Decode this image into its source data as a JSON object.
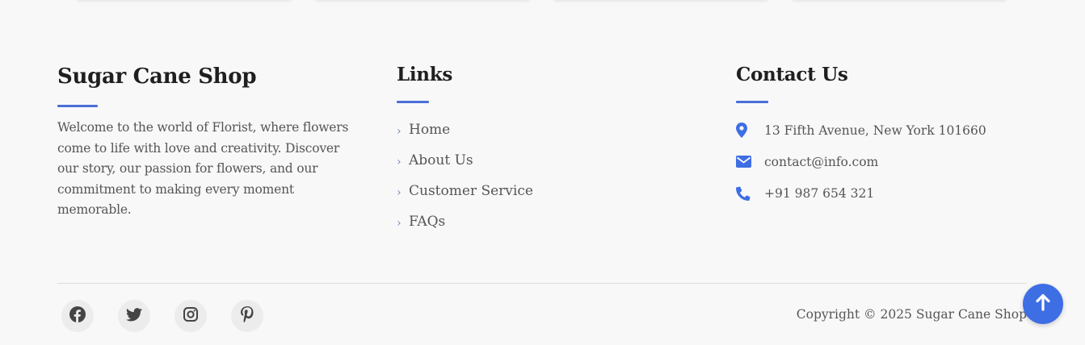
{
  "brand": {
    "title": "Sugar Cane Shop",
    "description": "Welcome to the world of Florist, where flowers come to life with love and creativity. Discover our story, our passion for flowers, and our commitment to making every moment memorable."
  },
  "links": {
    "title": "Links",
    "items": [
      {
        "label": "Home"
      },
      {
        "label": "About Us"
      },
      {
        "label": "Customer Service"
      },
      {
        "label": "FAQs"
      }
    ]
  },
  "contact": {
    "title": "Contact Us",
    "address": "13 Fifth Avenue, New York 101660",
    "email": "contact@info.com",
    "phone": "+91 987 654 321"
  },
  "social": [
    {
      "icon": "facebook-icon"
    },
    {
      "icon": "twitter-icon"
    },
    {
      "icon": "instagram-icon"
    },
    {
      "icon": "pinterest-icon"
    }
  ],
  "copyright": "Copyright © 2025 Sugar Cane Shop",
  "colors": {
    "accent": "#3e6ee4",
    "background": "#f8f8f8",
    "heading": "#1f1f1f",
    "text": "#555555"
  },
  "icons": {
    "link_bullet": "chevron-right-icon",
    "address": "map-pin-icon",
    "email": "envelope-icon",
    "phone": "phone-icon",
    "scroll_top": "arrow-up-icon"
  }
}
